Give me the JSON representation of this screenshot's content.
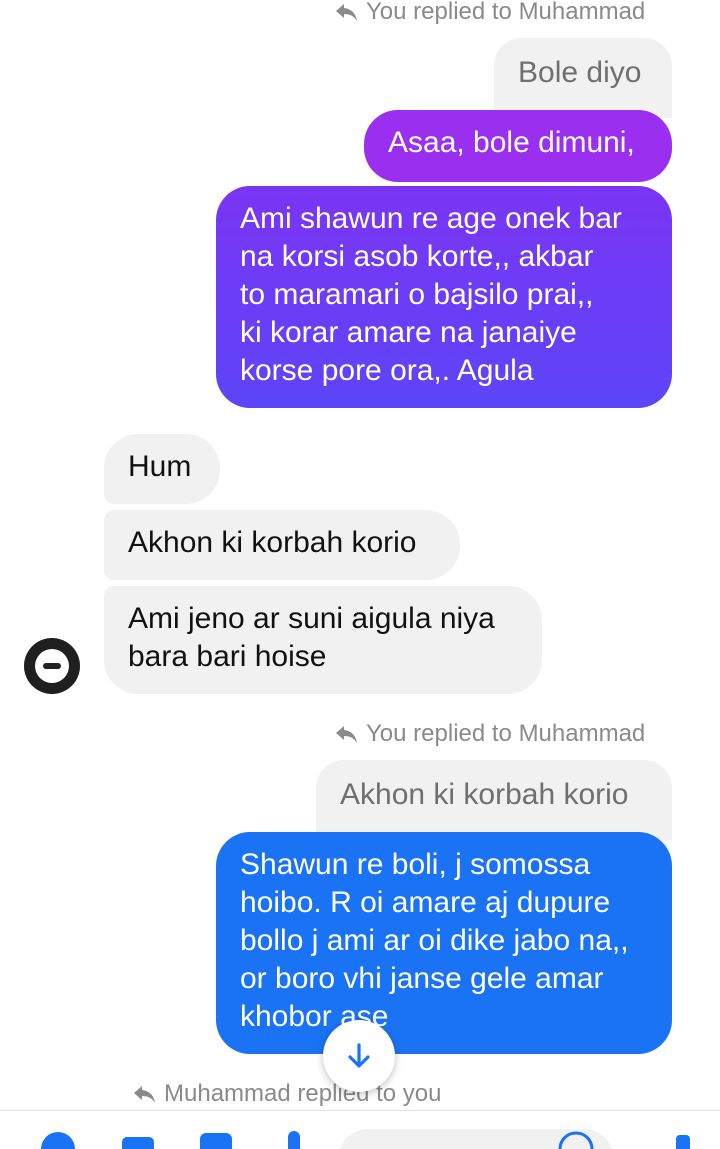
{
  "reply_notes": {
    "top": "You replied to Muhammad",
    "middle": "You replied to Muhammad",
    "bottom": "Muhammad replied to you"
  },
  "quotes": {
    "first": "Bole diyo",
    "second": "Akhon ki korbah korio"
  },
  "messages": {
    "out_1": [
      "Asaa, bole dimuni,"
    ],
    "out_2": [
      "Ami shawun re age onek bar",
      "na korsi asob korte,,  akbar",
      "to maramari o bajsilo prai,,",
      "ki korar amare na janaiye",
      "korse pore ora,. Agula"
    ],
    "in_1": [
      "Hum"
    ],
    "in_2": [
      "Akhon ki korbah korio"
    ],
    "in_3": [
      "Ami jeno ar suni aigula niya",
      "bara bari hoise"
    ],
    "out_3": [
      "Shawun re boli,  j somossa",
      "hoibo.  R oi amare aj dupure",
      "bollo j ami ar oi dike jabo na,,",
      "or boro vhi janse gele amar",
      "khobor ase"
    ]
  },
  "colors": {
    "purple": "#9a2ff0",
    "violet": "#6f3bf6",
    "blue": "#1a73f5",
    "incoming_bg": "#f1f1f1",
    "meta_text": "#8a8a8a"
  },
  "icons": {
    "reply": "reply-arrow-icon",
    "scroll": "arrow-down-icon",
    "avatar": "contact-avatar"
  }
}
